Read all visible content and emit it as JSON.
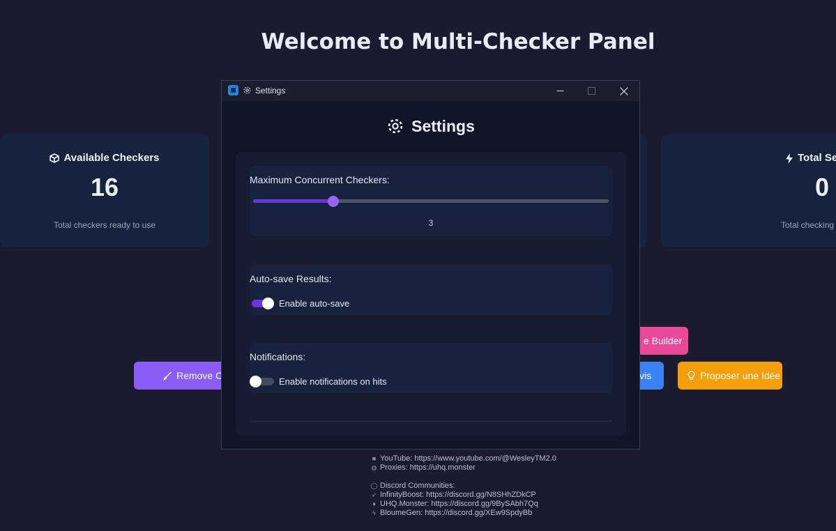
{
  "page": {
    "title": "Welcome to Multi-Checker Panel"
  },
  "stats": [
    {
      "icon": "cube-icon",
      "label": "Available Checkers",
      "value": "16",
      "description": "Total checkers ready to use"
    },
    {
      "icon": "bolt-icon",
      "label": "Total Se",
      "value": "0",
      "description": "Total checking s"
    }
  ],
  "buttons": {
    "remove": "Remove Ca",
    "builder": "e Builder",
    "avis": "vis",
    "idea": "Proposer une Idée"
  },
  "footer": {
    "youtube": "YouTube: https://www.youtube.com/@WesleyTM2.0",
    "proxies": "Proxies: https://uhq.monster",
    "discord_heading": "Discord Communities:",
    "infinityboost": "InfinityBoost: https://discord.gg/N8SHhZDkCP",
    "uhq": "UHQ.Monster: https://discord.gg/9BySAbh7Qq",
    "bloume": "BloumeGen: https://discord.gg/XEw9SpdyBb"
  },
  "settings_window": {
    "title": "Settings",
    "heading": "Settings",
    "max_concurrent": {
      "label": "Maximum Concurrent Checkers:",
      "value": "3",
      "fraction": 0.225
    },
    "autosave": {
      "label": "Auto-save Results:",
      "toggle_label": "Enable auto-save",
      "enabled": true
    },
    "notifications": {
      "label": "Notifications:",
      "toggle_label": "Enable notifications on hits",
      "enabled": false
    }
  },
  "colors": {
    "background": "#1a1b2e",
    "card": "#16233f",
    "accent_purple": "#8b5cf6",
    "accent_pink": "#ec4899",
    "accent_blue": "#3b82f6",
    "accent_orange": "#f59e0b",
    "slider_fill": "#6d35dc",
    "toggle_on": "#6d35dc",
    "toggle_off": "#454b5c"
  }
}
